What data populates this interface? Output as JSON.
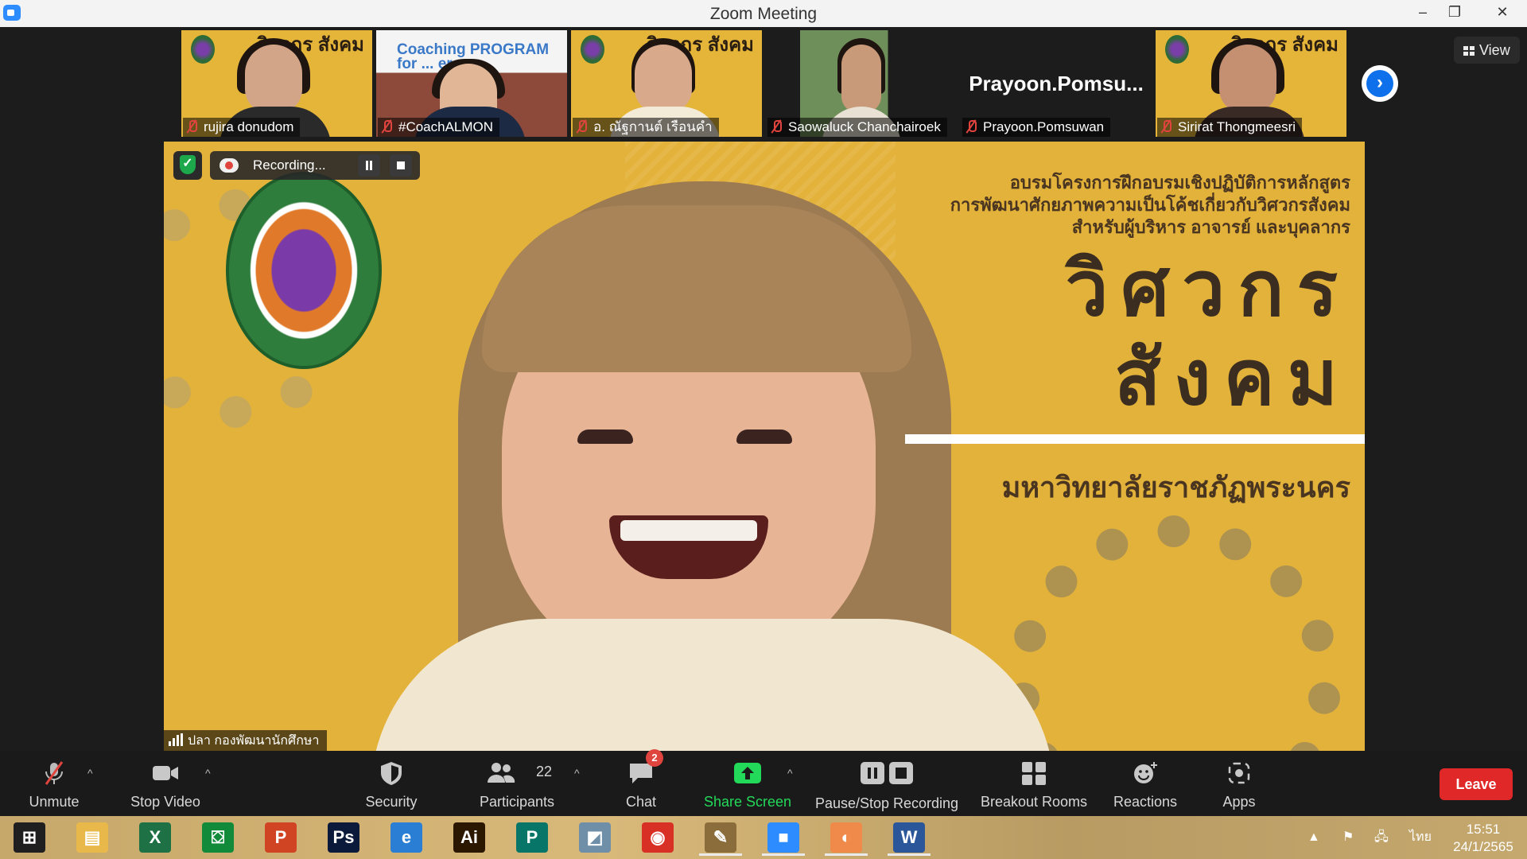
{
  "window": {
    "title": "Zoom Meeting",
    "min_glyph": "–",
    "max_glyph": "❐",
    "close_glyph": "✕"
  },
  "gallery": {
    "participants": [
      {
        "name": "rujira donudom",
        "muted": true
      },
      {
        "name": "#CoachALMON",
        "muted": true,
        "slide_text": "Coaching PROGRAM for ... er"
      },
      {
        "name": "อ. ณัฐกานต์  เรือนคำ",
        "muted": true
      },
      {
        "name": "Saowaluck Chanchairoek",
        "muted": true
      },
      {
        "name": "Prayoon.Pomsuwan",
        "muted": true,
        "tile_label": "Prayoon.Pomsu..."
      },
      {
        "name": "Sirirat Thongmeesri",
        "muted": true
      }
    ],
    "thumb_slide_title": "วิศวกร สังคม",
    "next_glyph": "›",
    "view_label": "View"
  },
  "main_video": {
    "recording_label": "Recording...",
    "speaker_name": "ปลา กองพัฒนานักศึกษา",
    "banner": {
      "line1": "อบรมโครงการฝึกอบรมเชิงปฏิบัติการหลักสูตร",
      "line2": "การพัฒนาศักยภาพความเป็นโค้ชเกี่ยวกับวิศวกรสังคม",
      "line3": "สำหรับผู้บริหาร อาจารย์ และบุคลากร",
      "big1": "วิศวกร",
      "big2": "สังคม",
      "university": "มหาวิทยาลัยราชภัฏพระนคร"
    }
  },
  "toolbar": {
    "unmute": "Unmute",
    "stop_video": "Stop Video",
    "security": "Security",
    "participants": "Participants",
    "participants_count": "22",
    "chat": "Chat",
    "chat_badge": "2",
    "share_screen": "Share Screen",
    "pause_stop_recording": "Pause/Stop Recording",
    "breakout_rooms": "Breakout Rooms",
    "reactions": "Reactions",
    "apps": "Apps",
    "leave": "Leave",
    "caret": "^"
  },
  "taskbar": {
    "apps": [
      {
        "name": "windows-start",
        "glyph": "⊞",
        "color": "#1f1f1f"
      },
      {
        "name": "file-explorer",
        "glyph": "▤",
        "color": "#e8b84a"
      },
      {
        "name": "excel",
        "glyph": "X",
        "color": "#1e7145"
      },
      {
        "name": "microsoft-store",
        "glyph": "⛋",
        "color": "#118a3a"
      },
      {
        "name": "powerpoint",
        "glyph": "P",
        "color": "#d04423"
      },
      {
        "name": "photoshop",
        "glyph": "Ps",
        "color": "#0b1a3a"
      },
      {
        "name": "internet-explorer",
        "glyph": "e",
        "color": "#2a7fd4"
      },
      {
        "name": "illustrator",
        "glyph": "Ai",
        "color": "#2b1600"
      },
      {
        "name": "publisher",
        "glyph": "P",
        "color": "#077568"
      },
      {
        "name": "notes-app",
        "glyph": "◩",
        "color": "#6f8fa8"
      },
      {
        "name": "chrome",
        "glyph": "◉",
        "color": "#d93025"
      },
      {
        "name": "paint-app",
        "glyph": "✎",
        "color": "#8a6d3b"
      },
      {
        "name": "zoom",
        "glyph": "■",
        "color": "#2d8cff"
      },
      {
        "name": "slides-app",
        "glyph": "◐",
        "color": "#f08a4b"
      },
      {
        "name": "word",
        "glyph": "W",
        "color": "#2b579a"
      }
    ],
    "tray_caret": "▲",
    "language": "ไทย",
    "time": "15:51",
    "date": "24/1/2565"
  }
}
